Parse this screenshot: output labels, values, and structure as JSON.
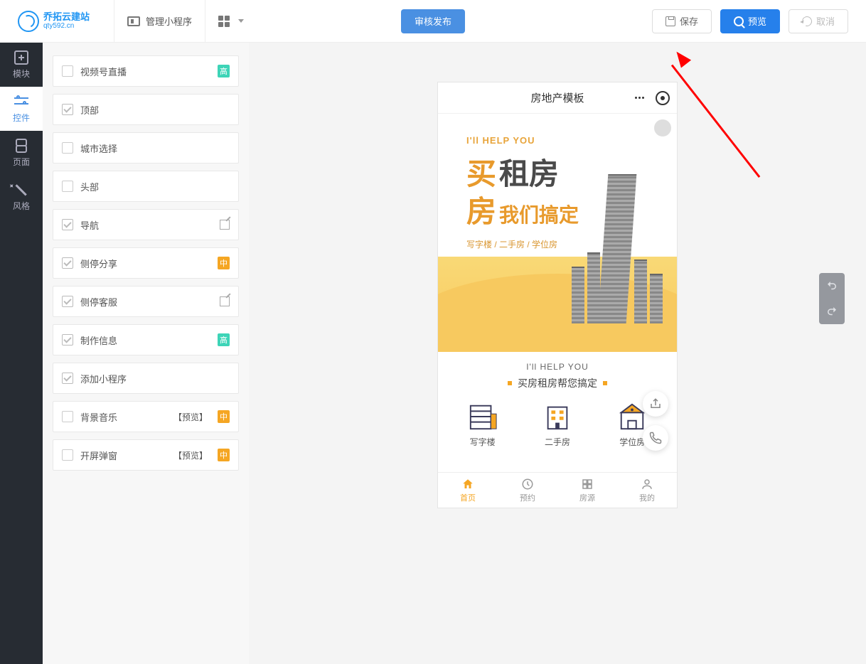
{
  "logo": {
    "main": "乔拓云建站",
    "sub": "qty592.cn"
  },
  "topbar": {
    "manage": "管理小程序",
    "publish": "审核发布",
    "save": "保存",
    "preview": "预览",
    "cancel": "取消"
  },
  "rail": {
    "modules": "模块",
    "controls": "控件",
    "pages": "页面",
    "styles": "风格"
  },
  "controls": [
    {
      "label": "视频号直播",
      "checked": false,
      "badge": "高",
      "badgeClass": "gao"
    },
    {
      "label": "顶部",
      "checked": true
    },
    {
      "label": "城市选择",
      "checked": false
    },
    {
      "label": "头部",
      "checked": false
    },
    {
      "label": "导航",
      "checked": true,
      "edit": true
    },
    {
      "label": "侧停分享",
      "checked": true,
      "badge": "中",
      "badgeClass": "zhong"
    },
    {
      "label": "侧停客服",
      "checked": true,
      "edit": true
    },
    {
      "label": "制作信息",
      "checked": true,
      "badge": "高",
      "badgeClass": "gao"
    },
    {
      "label": "添加小程序",
      "checked": true
    },
    {
      "label": "背景音乐",
      "checked": false,
      "previewTag": "【预览】",
      "badge": "中",
      "badgeClass": "zhong"
    },
    {
      "label": "开屏弹窗",
      "checked": false,
      "previewTag": "【预览】",
      "badge": "中",
      "badgeClass": "zhong"
    }
  ],
  "phone": {
    "title": "房地产模板",
    "hero": {
      "small": "I'll HELP YOU",
      "big1": "买",
      "big2": "租房",
      "row2a": "房",
      "row2b": "我们搞定",
      "sub": "写字楼 / 二手房 / 学位房"
    },
    "promo": {
      "small": "I'll HELP YOU",
      "big": "买房租房帮您搞定"
    },
    "cats": [
      "写字楼",
      "二手房",
      "学位房"
    ],
    "tabs": [
      "首页",
      "预约",
      "房源",
      "我的"
    ]
  }
}
